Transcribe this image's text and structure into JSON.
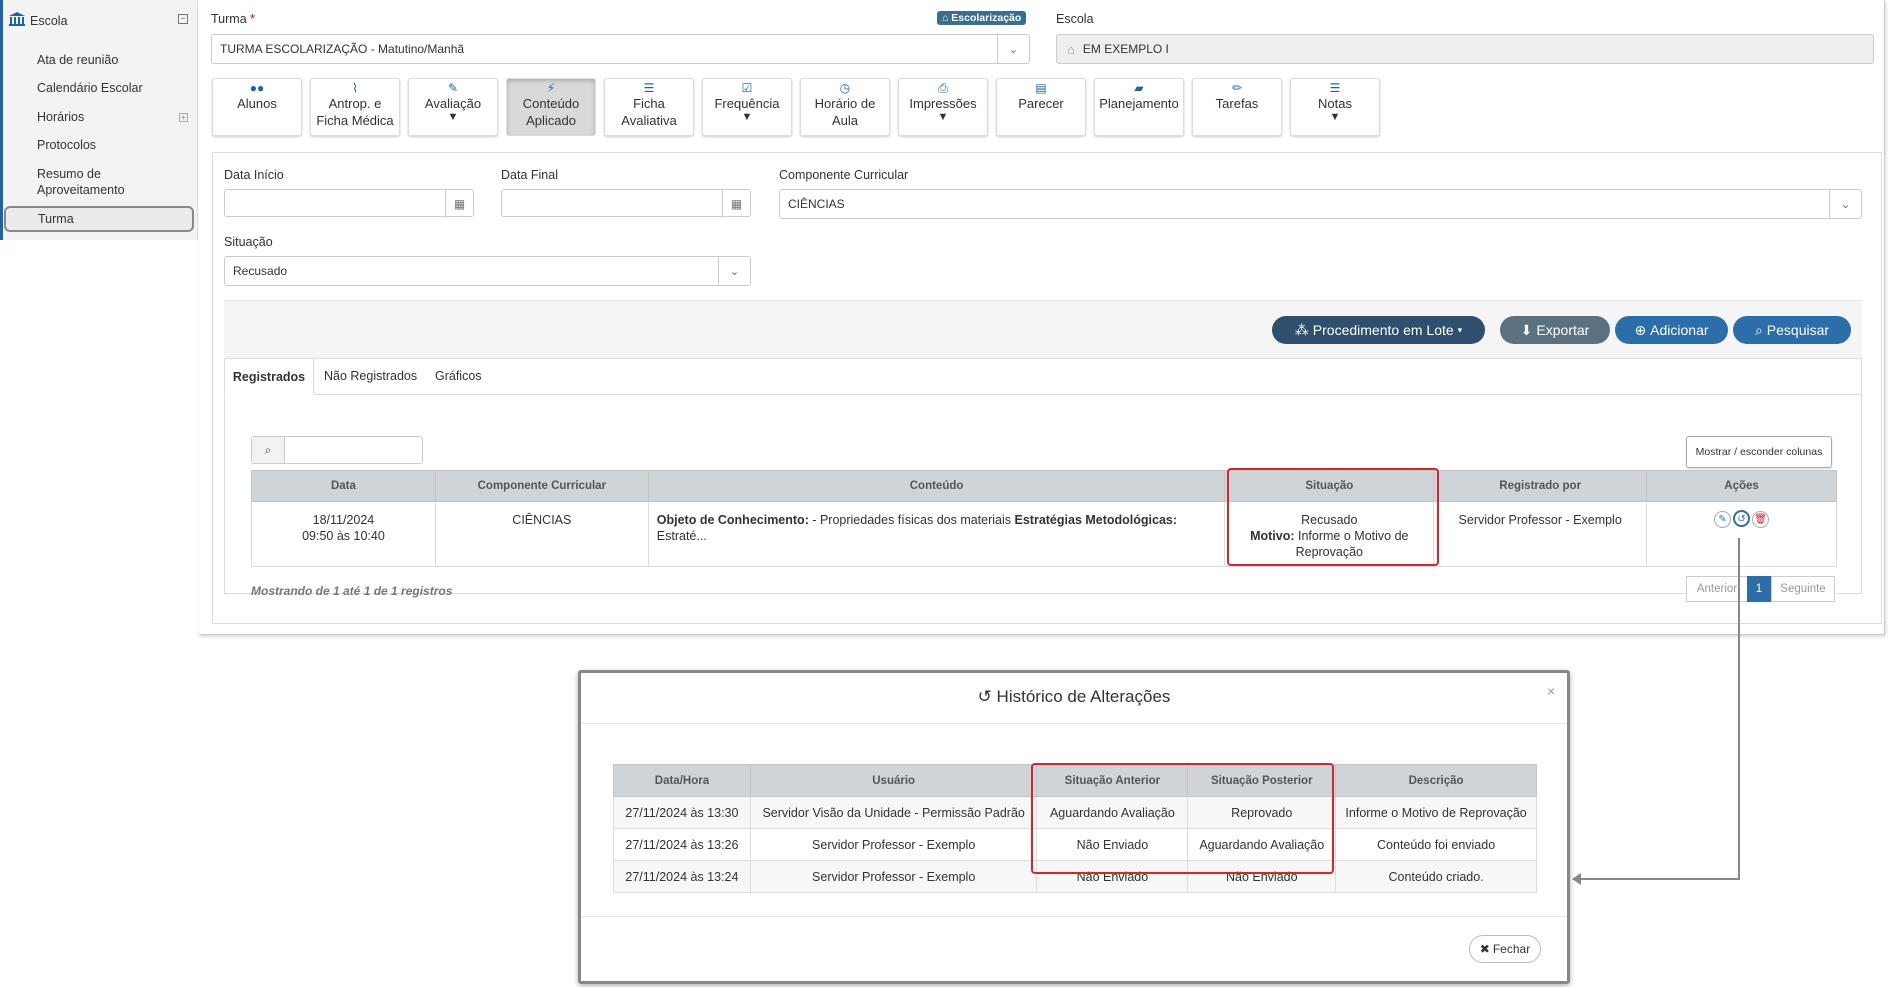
{
  "sidebar": {
    "header": "Escola",
    "items": [
      "Ata de reunião",
      "Calendário Escolar",
      "Horários",
      "Protocolos",
      "Resumo de",
      "Aproveitamento"
    ],
    "active": "Turma"
  },
  "form": {
    "turma_label": "Turma",
    "turma_required": "*",
    "turma_value": "TURMA ESCOLARIZAÇÃO - Matutino/Manhã",
    "tag": "Escolarização",
    "escola_label": "Escola",
    "escola_value": "EM EXEMPLO I"
  },
  "tiles": [
    {
      "l1": "Alunos",
      "l2": ""
    },
    {
      "l1": "Antrop. e",
      "l2": "Ficha Médica"
    },
    {
      "l1": "Avaliação",
      "l2": ""
    },
    {
      "l1": "Conteúdo",
      "l2": "Aplicado"
    },
    {
      "l1": "Ficha",
      "l2": "Avaliativa"
    },
    {
      "l1": "Frequência",
      "l2": ""
    },
    {
      "l1": "Horário de",
      "l2": "Aula"
    },
    {
      "l1": "Impressões",
      "l2": ""
    },
    {
      "l1": "Parecer",
      "l2": ""
    },
    {
      "l1": "Planejamento",
      "l2": ""
    },
    {
      "l1": "Tarefas",
      "l2": ""
    },
    {
      "l1": "Notas",
      "l2": ""
    }
  ],
  "filters": {
    "data_inicio_label": "Data Início",
    "data_final_label": "Data Final",
    "componente_label": "Componente Curricular",
    "componente_value": "CIÊNCIAS",
    "situacao_label": "Situação",
    "situacao_value": "Recusado"
  },
  "actions": {
    "lote": "Procedimento em Lote",
    "exportar": "Exportar",
    "adicionar": "Adicionar",
    "pesquisar": "Pesquisar"
  },
  "tabs": [
    "Registrados",
    "Não Registrados",
    "Gráficos"
  ],
  "table": {
    "show_hide": "Mostrar / esconder colunas",
    "headers": [
      "Data",
      "Componente Curricular",
      "Conteúdo",
      "Situação",
      "Registrado por",
      "Ações"
    ],
    "row": {
      "data1": "18/11/2024",
      "data2": "09:50 às 10:40",
      "componente": "CIÊNCIAS",
      "conteudo_b1": "Objeto de Conhecimento:",
      "conteudo_t1": " - Propriedades físicas dos materiais ",
      "conteudo_b2": "Estratégias Metodológicas:",
      "conteudo_t2": " Estraté...",
      "situacao": "Recusado",
      "motivo_label": "Motivo:",
      "motivo_1": " Informe o Motivo de",
      "motivo_2": "Reprovação",
      "registrado": "Servidor Professor - Exemplo"
    },
    "showing": "Mostrando de 1 até 1 de 1 registros",
    "pagination": {
      "prev": "Anterior",
      "page": "1",
      "next": "Seguinte"
    }
  },
  "modal": {
    "title": "Histórico de Alterações",
    "close": "×",
    "headers": [
      "Data/Hora",
      "Usuário",
      "Situação Anterior",
      "Situação Posterior",
      "Descrição"
    ],
    "rows": [
      [
        "27/11/2024 às 13:30",
        "Servidor Visão da Unidade - Permissão Padrão",
        "Aguardando Avaliação",
        "Reprovado",
        "Informe o Motivo de Reprovação"
      ],
      [
        "27/11/2024 às 13:26",
        "Servidor Professor - Exemplo",
        "Não Enviado",
        "Aguardando Avaliação",
        "Conteúdo foi enviado"
      ],
      [
        "27/11/2024 às 13:24",
        "Servidor Professor - Exemplo",
        "Não Enviado",
        "Não Enviado",
        "Conteúdo criado."
      ]
    ],
    "fechar": "Fechar"
  },
  "colors": {
    "primary": "#2b6ea9",
    "dark": "#2e4f6e",
    "highlight": "#d9232d"
  }
}
